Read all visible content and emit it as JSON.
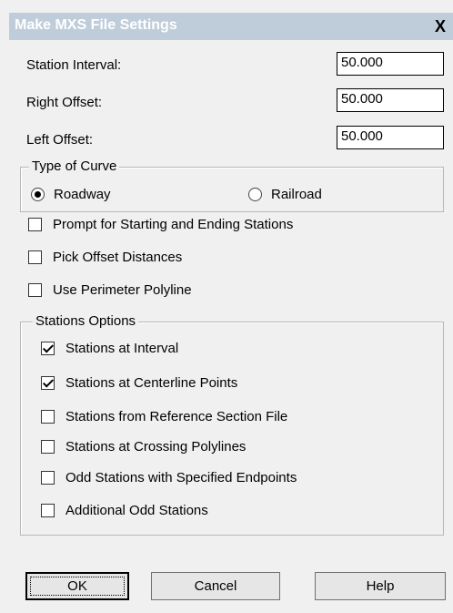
{
  "window": {
    "title": "Make MXS File Settings",
    "close_icon": "X"
  },
  "fields": {
    "station_interval": {
      "label": "Station Interval:",
      "value": "50.000"
    },
    "right_offset": {
      "label": "Right Offset:",
      "value": "50.000"
    },
    "left_offset": {
      "label": "Left Offset:",
      "value": "50.000"
    }
  },
  "curve_type": {
    "title": "Type of Curve",
    "options": [
      {
        "label": "Roadway",
        "selected": true
      },
      {
        "label": "Railroad",
        "selected": false
      }
    ]
  },
  "options": [
    {
      "label": "Prompt for Starting and Ending Stations",
      "checked": false
    },
    {
      "label": "Pick Offset Distances",
      "checked": false
    },
    {
      "label": "Use Perimeter Polyline",
      "checked": false
    }
  ],
  "stations_options": {
    "title": "Stations Options",
    "items": [
      {
        "label": "Stations at Interval",
        "checked": true
      },
      {
        "label": "Stations at Centerline Points",
        "checked": true
      },
      {
        "label": "Stations from Reference Section File",
        "checked": false
      },
      {
        "label": "Stations at Crossing Polylines",
        "checked": false
      },
      {
        "label": "Odd Stations with Specified Endpoints",
        "checked": false
      },
      {
        "label": "Additional Odd Stations",
        "checked": false
      }
    ]
  },
  "buttons": {
    "ok": "OK",
    "cancel": "Cancel",
    "help": "Help"
  }
}
